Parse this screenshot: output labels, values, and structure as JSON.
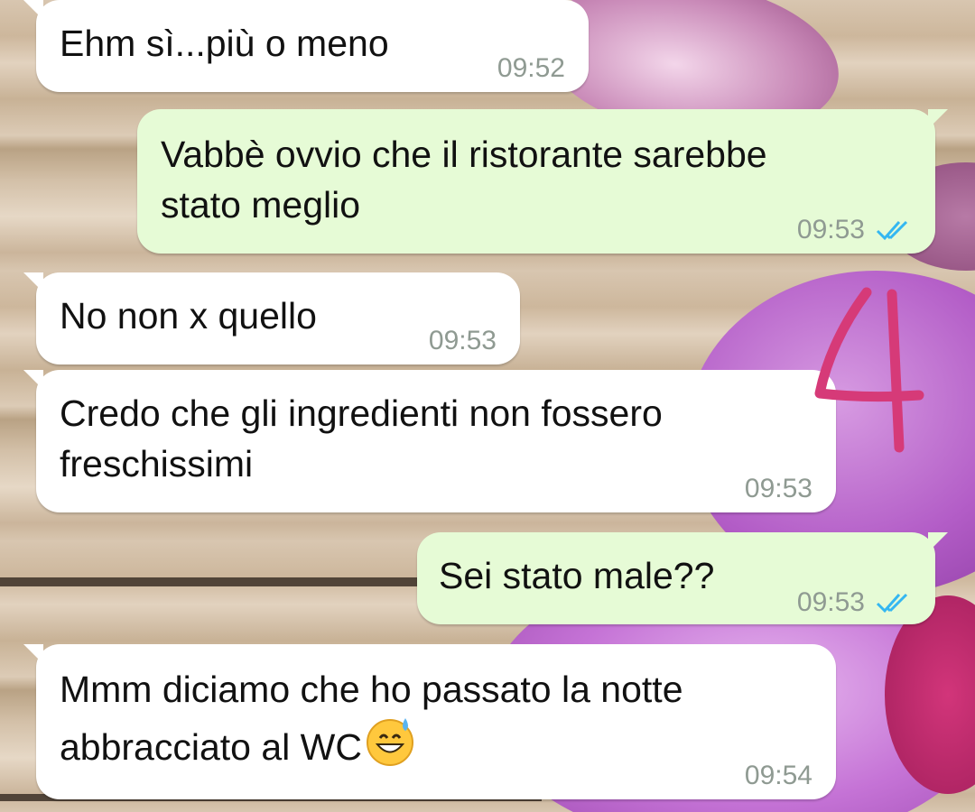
{
  "messages": [
    {
      "direction": "incoming",
      "text": "Ehm sì...più o meno",
      "time": "09:52"
    },
    {
      "direction": "outgoing",
      "text": "Vabbè ovvio che il ristorante sarebbe\nstato meglio",
      "time": "09:53",
      "status": "read",
      "status_icon": "double-check-icon"
    },
    {
      "direction": "incoming",
      "text": "No non x quello",
      "time": "09:53"
    },
    {
      "direction": "incoming",
      "text": "Credo che gli ingredienti non fossero\nfreschissimi",
      "time": "09:53"
    },
    {
      "direction": "outgoing",
      "text": "Sei stato male??",
      "time": "09:53",
      "status": "read",
      "status_icon": "double-check-icon"
    },
    {
      "direction": "incoming",
      "text": "Mmm diciamo che ho passato la notte\nabbracciato al WC",
      "time": "09:54",
      "emoji": "grinning-face-with-sweat-emoji"
    }
  ],
  "annotation": {
    "label": "4",
    "color": "#d63a78"
  },
  "colors": {
    "outgoing_bubble": "#e6fbd6",
    "incoming_bubble": "#ffffff",
    "read_ticks": "#34b7f1",
    "timestamp": "#8f9a92"
  }
}
